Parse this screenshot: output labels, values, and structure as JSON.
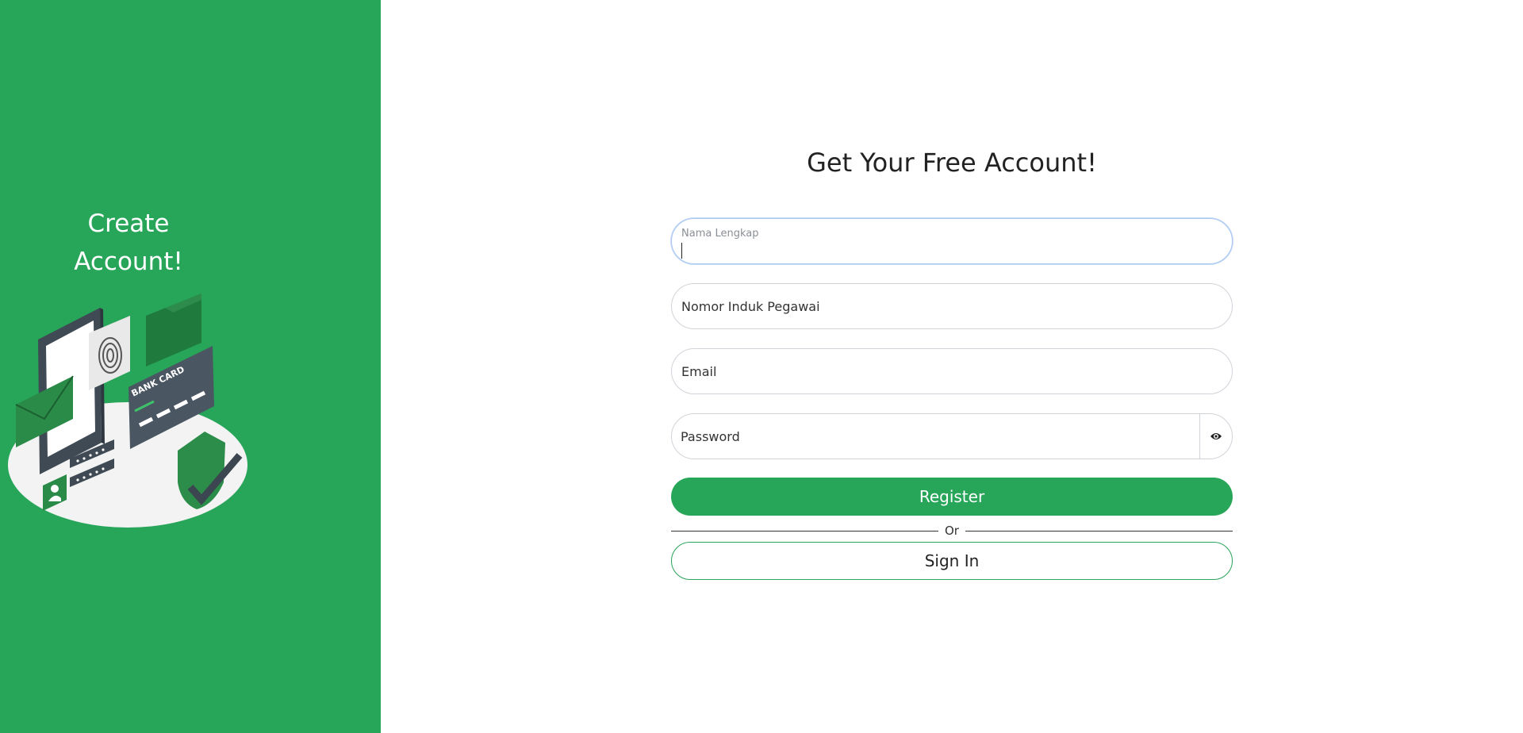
{
  "left": {
    "title_line1": "Create",
    "title_line2": "Account!",
    "illustration": {
      "card_text": "BANK CARD",
      "icons": [
        "phone-icon",
        "fingerprint-icon",
        "folder-icon",
        "envelope-icon",
        "bank-card-icon",
        "shield-check-icon",
        "user-id-icon",
        "password-icon"
      ]
    }
  },
  "form": {
    "title": "Get Your Free Account!",
    "fields": {
      "nama": {
        "placeholder": "Nama Lengkap",
        "value": ""
      },
      "nip": {
        "placeholder": "Nomor Induk Pegawai",
        "value": ""
      },
      "email": {
        "placeholder": "Email",
        "value": ""
      },
      "password": {
        "placeholder": "Password",
        "value": ""
      }
    },
    "register_label": "Register",
    "or_label": "Or",
    "signin_label": "Sign In"
  },
  "colors": {
    "brand": "#27a559",
    "focus_border": "#a9c8f0",
    "text": "#222222"
  }
}
